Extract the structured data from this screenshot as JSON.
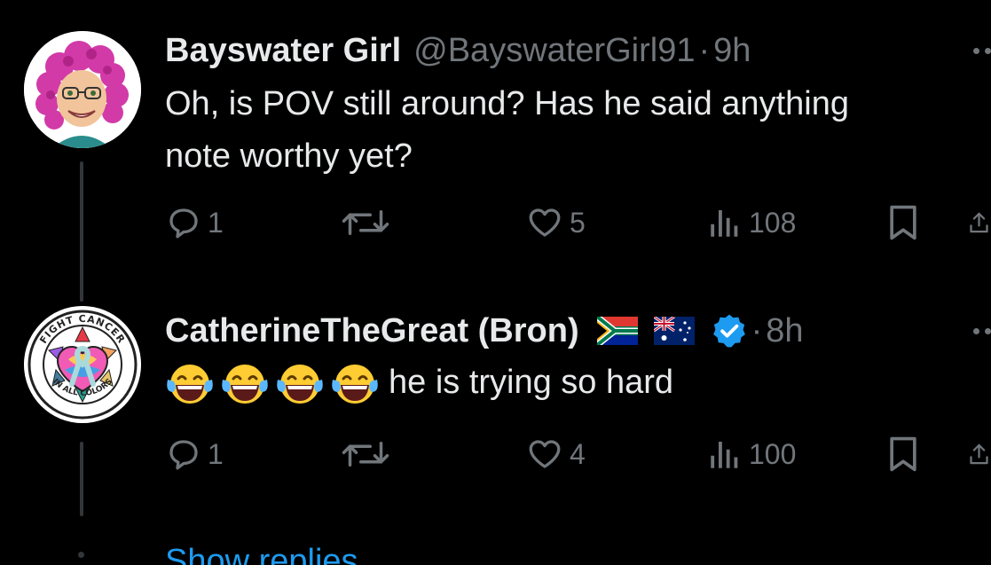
{
  "tweets": [
    {
      "name": "Bayswater Girl",
      "handle": "@BayswaterGirl91",
      "dot": "·",
      "time": "9h",
      "lines": [
        "Oh, is POV still around?  Has he said anything",
        "note worthy yet?"
      ],
      "replies": "1",
      "likes": "5",
      "views": "108"
    },
    {
      "name": "CatherineTheGreat (Bron)",
      "dot": "·",
      "time": "8h",
      "text": "he is trying so hard",
      "flags": [
        "south-africa-flag",
        "australia-flag"
      ],
      "verified": true,
      "avatar_text_top": "FIGHT CANCER",
      "avatar_text_bottom": "IN ALL COLORS",
      "replies": "1",
      "likes": "4",
      "views": "100"
    }
  ],
  "show_replies": "Show replies",
  "colors": {
    "accent": "#1d9bf0",
    "muted": "#71767b",
    "text": "#e7e9ea",
    "line": "#333639"
  },
  "icons": [
    "reply-icon",
    "retweet-icon",
    "like-icon",
    "views-icon",
    "bookmark-icon",
    "share-icon",
    "more-icon",
    "verified-icon",
    "tears-of-joy-emoji"
  ]
}
